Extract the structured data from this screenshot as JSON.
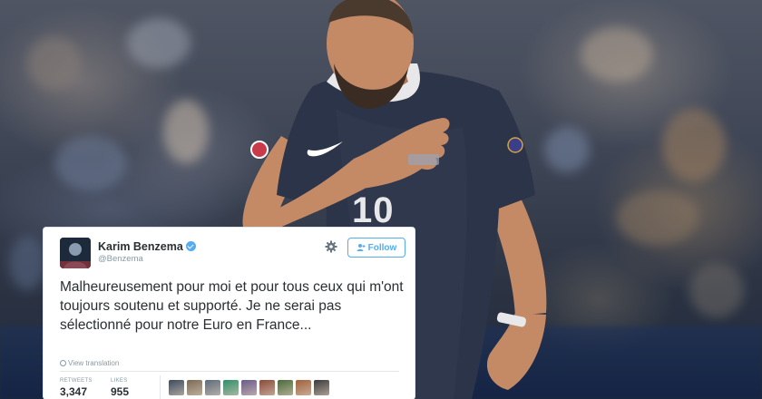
{
  "tweet": {
    "display_name": "Karim Benzema",
    "handle": "@Benzema",
    "follow_label": "Follow",
    "text": "Malheureusement pour moi et pour tous ceux qui m'ont toujours soutenu et supporté. Je ne serai pas sélectionné pour notre Euro en France...",
    "translate_label": "View translation",
    "stats": {
      "retweets_label": "RETWEETS",
      "retweets_value": "3,347",
      "likes_label": "LIKES",
      "likes_value": "955"
    },
    "liker_avatar_colors": [
      "#3b4a5e",
      "#7a6a55",
      "#5c6b7a",
      "#2f8f6a",
      "#6b5a8a",
      "#8a4a3a",
      "#4a6a3a",
      "#a0603a",
      "#3a3a3a"
    ]
  },
  "photo": {
    "jersey_number": "10",
    "colors": {
      "jersey": "#2b3448",
      "skin": "#c48a66",
      "collar": "#e8e8ea"
    }
  },
  "colors": {
    "accent": "#55acee",
    "text": "#292f33",
    "muted": "#8899a6"
  }
}
